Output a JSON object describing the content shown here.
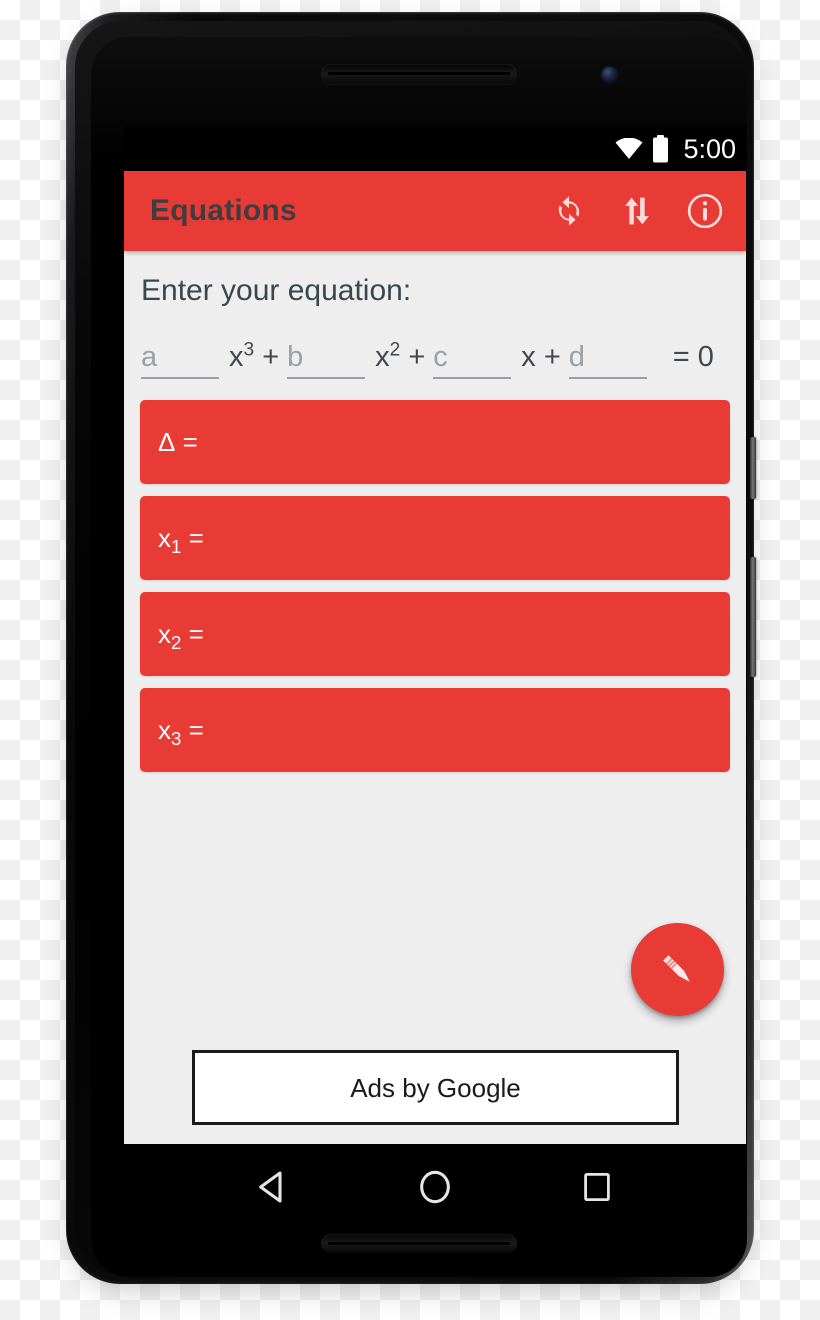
{
  "device": {
    "type": "android-smartphone",
    "hardware": {
      "earpiece": "speaker-grille",
      "front_camera": "camera-lens",
      "power_button": "power-button",
      "volume_button": "volume-rocker"
    }
  },
  "status_bar": {
    "time": "5:00",
    "icons": [
      "wifi-icon",
      "battery-icon"
    ]
  },
  "app_bar": {
    "title": "Equations",
    "title_color": "#3d3d42",
    "background_color": "#e83b35",
    "actions": [
      {
        "name": "refresh-icon",
        "label": "Refresh"
      },
      {
        "name": "swap-vert-icon",
        "label": "Swap"
      },
      {
        "name": "info-icon",
        "label": "Info"
      }
    ]
  },
  "content": {
    "background_color": "#eeeeee",
    "prompt": "Enter your equation:",
    "equation": {
      "terms": [
        {
          "hint": "a",
          "placeholder": "a",
          "value": "",
          "suffix": "x³ +"
        },
        {
          "hint": "b",
          "placeholder": "b",
          "value": "",
          "suffix": "x² +"
        },
        {
          "hint": "c",
          "placeholder": "c",
          "value": "",
          "suffix": "x +"
        },
        {
          "hint": "d",
          "placeholder": "d",
          "value": "",
          "suffix": ""
        }
      ],
      "equals": "= 0"
    },
    "results": [
      {
        "name": "delta",
        "label": "Δ",
        "sub": "",
        "equals": "=",
        "value": ""
      },
      {
        "name": "x1",
        "label": "x",
        "sub": "1",
        "equals": "=",
        "value": ""
      },
      {
        "name": "x2",
        "label": "x",
        "sub": "2",
        "equals": "=",
        "value": ""
      },
      {
        "name": "x3",
        "label": "x",
        "sub": "3",
        "equals": "=",
        "value": ""
      }
    ],
    "result_bar_color": "#e83b35",
    "fab": {
      "icon": "pencil-icon",
      "color": "#e83b35"
    },
    "ad": {
      "text": "Ads by Google"
    }
  },
  "nav_bar": {
    "buttons": [
      {
        "name": "back-button",
        "icon": "back-triangle-icon"
      },
      {
        "name": "home-button",
        "icon": "home-circle-icon"
      },
      {
        "name": "recents-button",
        "icon": "recents-square-icon"
      }
    ]
  }
}
